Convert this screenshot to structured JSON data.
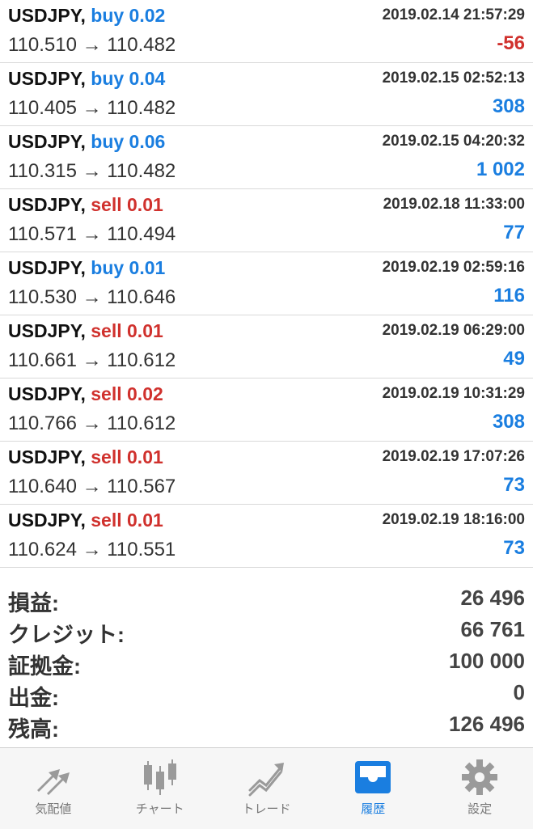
{
  "trades": [
    {
      "symbol": "USDJPY,",
      "type": "buy 0.02",
      "side": "buy",
      "time": "2019.02.14 21:57:29",
      "prices": "110.510 → 110.482",
      "profit": "-56"
    },
    {
      "symbol": "USDJPY,",
      "type": "buy 0.04",
      "side": "buy",
      "time": "2019.02.15 02:52:13",
      "prices": "110.405 → 110.482",
      "profit": "308"
    },
    {
      "symbol": "USDJPY,",
      "type": "buy 0.06",
      "side": "buy",
      "time": "2019.02.15 04:20:32",
      "prices": "110.315 → 110.482",
      "profit": "1 002"
    },
    {
      "symbol": "USDJPY,",
      "type": "sell 0.01",
      "side": "sell",
      "time": "2019.02.18 11:33:00",
      "prices": "110.571 → 110.494",
      "profit": "77"
    },
    {
      "symbol": "USDJPY,",
      "type": "buy 0.01",
      "side": "buy",
      "time": "2019.02.19 02:59:16",
      "prices": "110.530 → 110.646",
      "profit": "116"
    },
    {
      "symbol": "USDJPY,",
      "type": "sell 0.01",
      "side": "sell",
      "time": "2019.02.19 06:29:00",
      "prices": "110.661 → 110.612",
      "profit": "49"
    },
    {
      "symbol": "USDJPY,",
      "type": "sell 0.02",
      "side": "sell",
      "time": "2019.02.19 10:31:29",
      "prices": "110.766 → 110.612",
      "profit": "308"
    },
    {
      "symbol": "USDJPY,",
      "type": "sell 0.01",
      "side": "sell",
      "time": "2019.02.19 17:07:26",
      "prices": "110.640 → 110.567",
      "profit": "73"
    },
    {
      "symbol": "USDJPY,",
      "type": "sell 0.01",
      "side": "sell",
      "time": "2019.02.19 18:16:00",
      "prices": "110.624 → 110.551",
      "profit": "73"
    }
  ],
  "summary": {
    "profit_label": "損益:",
    "profit_value": "26 496",
    "credit_label": "クレジット:",
    "credit_value": "66 761",
    "deposit_label": "証拠金:",
    "deposit_value": "100 000",
    "withdrawal_label": "出金:",
    "withdrawal_value": "0",
    "balance_label": "残高:",
    "balance_value": "126 496"
  },
  "tabs": [
    {
      "label": "気配値",
      "icon": "quotes-arrows-icon"
    },
    {
      "label": "チャート",
      "icon": "candlestick-chart-icon"
    },
    {
      "label": "トレード",
      "icon": "trade-trend-icon"
    },
    {
      "label": "履歴",
      "icon": "history-inbox-icon",
      "active": true
    },
    {
      "label": "設定",
      "icon": "gear-icon"
    }
  ],
  "colors": {
    "buy": "#1a7ee0",
    "sell": "#d0312d",
    "active_tab": "#1a7ee0",
    "inactive_tab": "#8a8a8a"
  }
}
